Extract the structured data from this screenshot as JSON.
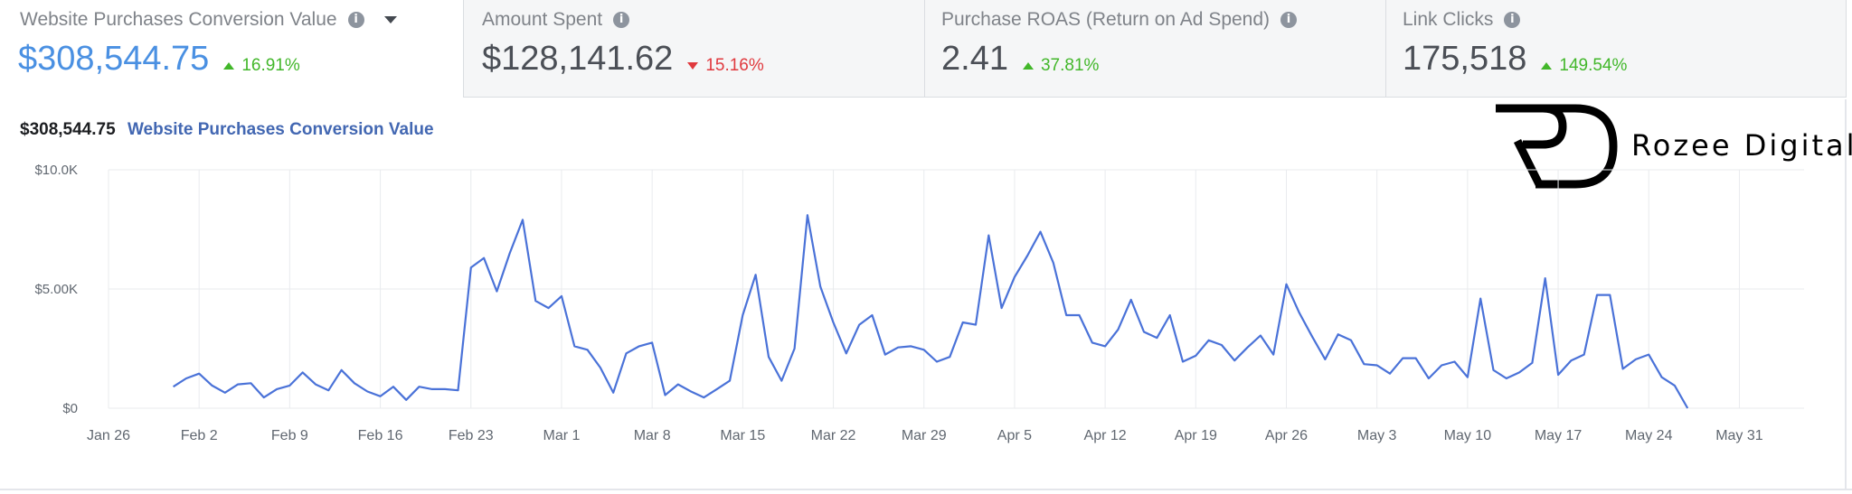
{
  "tabs": [
    {
      "label": "Website Purchases Conversion Value",
      "value": "$308,544.75",
      "delta": "16.91%",
      "direction": "up",
      "active": true,
      "icons": [
        "info-icon",
        "caret-down-icon"
      ]
    },
    {
      "label": "Amount Spent",
      "value": "$128,141.62",
      "delta": "15.16%",
      "direction": "down",
      "active": false,
      "icons": [
        "info-icon"
      ]
    },
    {
      "label": "Purchase ROAS (Return on Ad Spend)",
      "value": "2.41",
      "delta": "37.81%",
      "direction": "up",
      "active": false,
      "icons": [
        "info-icon"
      ]
    },
    {
      "label": "Link Clicks",
      "value": "175,518",
      "delta": "149.54%",
      "direction": "up",
      "active": false,
      "icons": [
        "info-icon"
      ]
    }
  ],
  "summary": {
    "value": "$308,544.75",
    "metric": "Website Purchases Conversion Value"
  },
  "logo": {
    "text": "Rozee Digital"
  },
  "colors": {
    "line": "#4a72d8",
    "accent": "#4a90e2",
    "positive": "#42b72a",
    "negative": "#e0393e"
  },
  "chart_data": {
    "type": "line",
    "title": "",
    "xlabel": "",
    "ylabel": "",
    "ylim": [
      0,
      10000
    ],
    "yticks": [
      0,
      5000,
      10000
    ],
    "ytick_labels": [
      "$0",
      "$5.00K",
      "$10.0K"
    ],
    "xticks": [
      0,
      7,
      14,
      21,
      28,
      35,
      42,
      49,
      56,
      63,
      70,
      77,
      84,
      91,
      98,
      105,
      112,
      119,
      126
    ],
    "xtick_labels": [
      "Jan 26",
      "Feb 2",
      "Feb 9",
      "Feb 16",
      "Feb 23",
      "Mar 1",
      "Mar 8",
      "Mar 15",
      "Mar 22",
      "Mar 29",
      "Apr 5",
      "Apr 12",
      "Apr 19",
      "Apr 26",
      "May 3",
      "May 10",
      "May 17",
      "May 24",
      "May 31"
    ],
    "x_unit": "days from Jan 26",
    "grid": true,
    "series": [
      {
        "name": "Website Purchases Conversion Value",
        "x_start": 5,
        "values": [
          900,
          1250,
          1450,
          950,
          650,
          1000,
          1050,
          450,
          800,
          950,
          1500,
          1000,
          750,
          1600,
          1050,
          700,
          500,
          900,
          350,
          900,
          800,
          800,
          750,
          5900,
          6300,
          4900,
          6500,
          7900,
          4500,
          4200,
          4700,
          2600,
          2450,
          1700,
          650,
          2300,
          2600,
          2750,
          550,
          1000,
          700,
          450,
          800,
          1150,
          3900,
          5600,
          2150,
          1150,
          2500,
          8100,
          5100,
          3600,
          2300,
          3500,
          3900,
          2250,
          2550,
          2600,
          2450,
          1950,
          2150,
          3600,
          3500,
          7250,
          4200,
          5500,
          6400,
          7400,
          6100,
          3900,
          3900,
          2750,
          2600,
          3300,
          4550,
          3200,
          2950,
          3900,
          1950,
          2200,
          2850,
          2650,
          2000,
          2550,
          3050,
          2250,
          5200,
          4000,
          3000,
          2050,
          3100,
          2850,
          1850,
          1800,
          1450,
          2100,
          2100,
          1250,
          1800,
          1950,
          1300,
          4600,
          1600,
          1250,
          1500,
          1900,
          5450,
          1400,
          2000,
          2250,
          4750,
          4750,
          1650,
          2050,
          2250,
          1300,
          950,
          0
        ]
      }
    ]
  }
}
